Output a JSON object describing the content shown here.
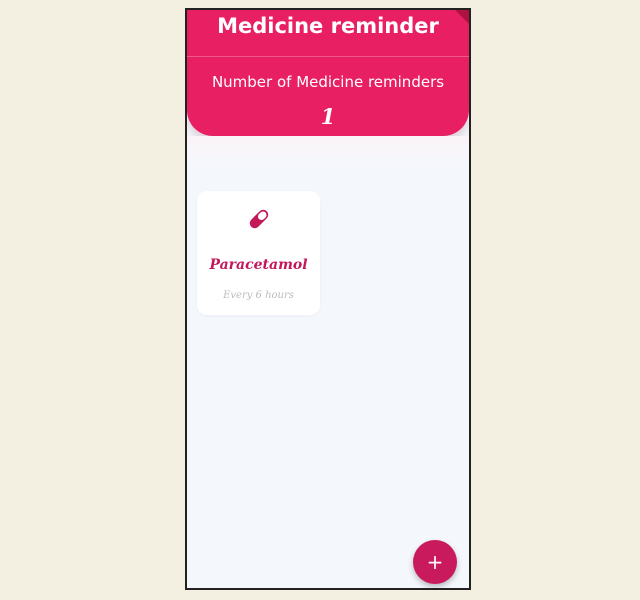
{
  "header": {
    "title": "Medicine reminder",
    "count_label": "Number of Medicine reminders",
    "count_value": "1"
  },
  "reminders": [
    {
      "name": "Paracetamol",
      "interval": "Every 6 hours",
      "icon": "pill-icon"
    }
  ],
  "fab": {
    "icon": "plus-icon",
    "glyph": "+"
  },
  "colors": {
    "primary": "#e81f63",
    "accent": "#c81a5c",
    "card_title": "#c4175a",
    "background": "#f4f8fd",
    "muted_text": "#bcbcbc"
  }
}
